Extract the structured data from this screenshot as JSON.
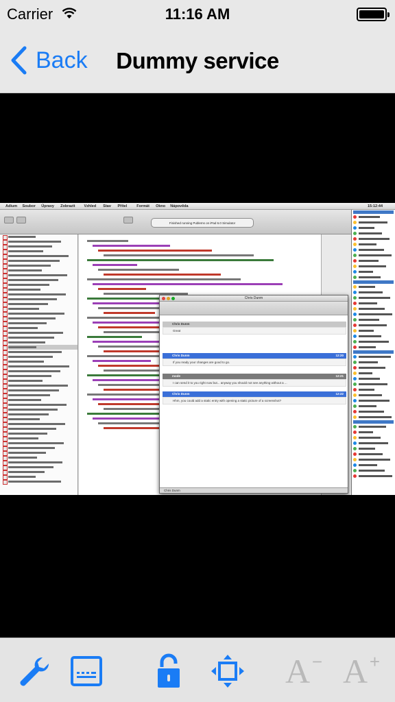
{
  "status_bar": {
    "carrier": "Carrier",
    "time": "11:16 AM"
  },
  "nav": {
    "back_label": "Back",
    "title": "Dummy service"
  },
  "screenshot": {
    "menubar": [
      "Adium",
      "Soubor",
      "Úpravy",
      "Zobrazit",
      "Vzhled",
      "Stav",
      "Přítel",
      "Formát",
      "Okno",
      "Nápověda"
    ],
    "menubar_time": "15:12:44",
    "xcode_status": "Finished running Publems on iPad 6.0 Simulator",
    "chat": {
      "window_title": "Chris Dunm",
      "tab_label": "Chris Dunm",
      "messages": [
        {
          "sender": "Chris Dunm",
          "time": "",
          "text": "Great",
          "style": "light"
        },
        {
          "sender": "Chris Dunm",
          "time": "12:20",
          "text": "If you ready your changes are good to go.",
          "style": "blue"
        },
        {
          "sender": "mode",
          "time": "12:21",
          "text": "I can send it to you right now but... anyway you should not see anything without a ...",
          "style": "grey"
        },
        {
          "sender": "Chris Dunm",
          "time": "12:22",
          "text": "Hhm, you could add a static entry with opening a static picture of a screenshot?",
          "style": "blue"
        }
      ]
    }
  },
  "toolbar": {
    "items": [
      "wrench-icon",
      "keyboard-icon",
      "unlock-icon",
      "resize-icon",
      "font-decrease-icon",
      "font-increase-icon"
    ],
    "font_decrease_label": "A",
    "font_decrease_sign": "−",
    "font_increase_label": "A",
    "font_increase_sign": "+"
  },
  "colors": {
    "accent": "#1a7cf5",
    "disabled": "#b9b9b9",
    "bar_bg": "#e8e8e8"
  }
}
